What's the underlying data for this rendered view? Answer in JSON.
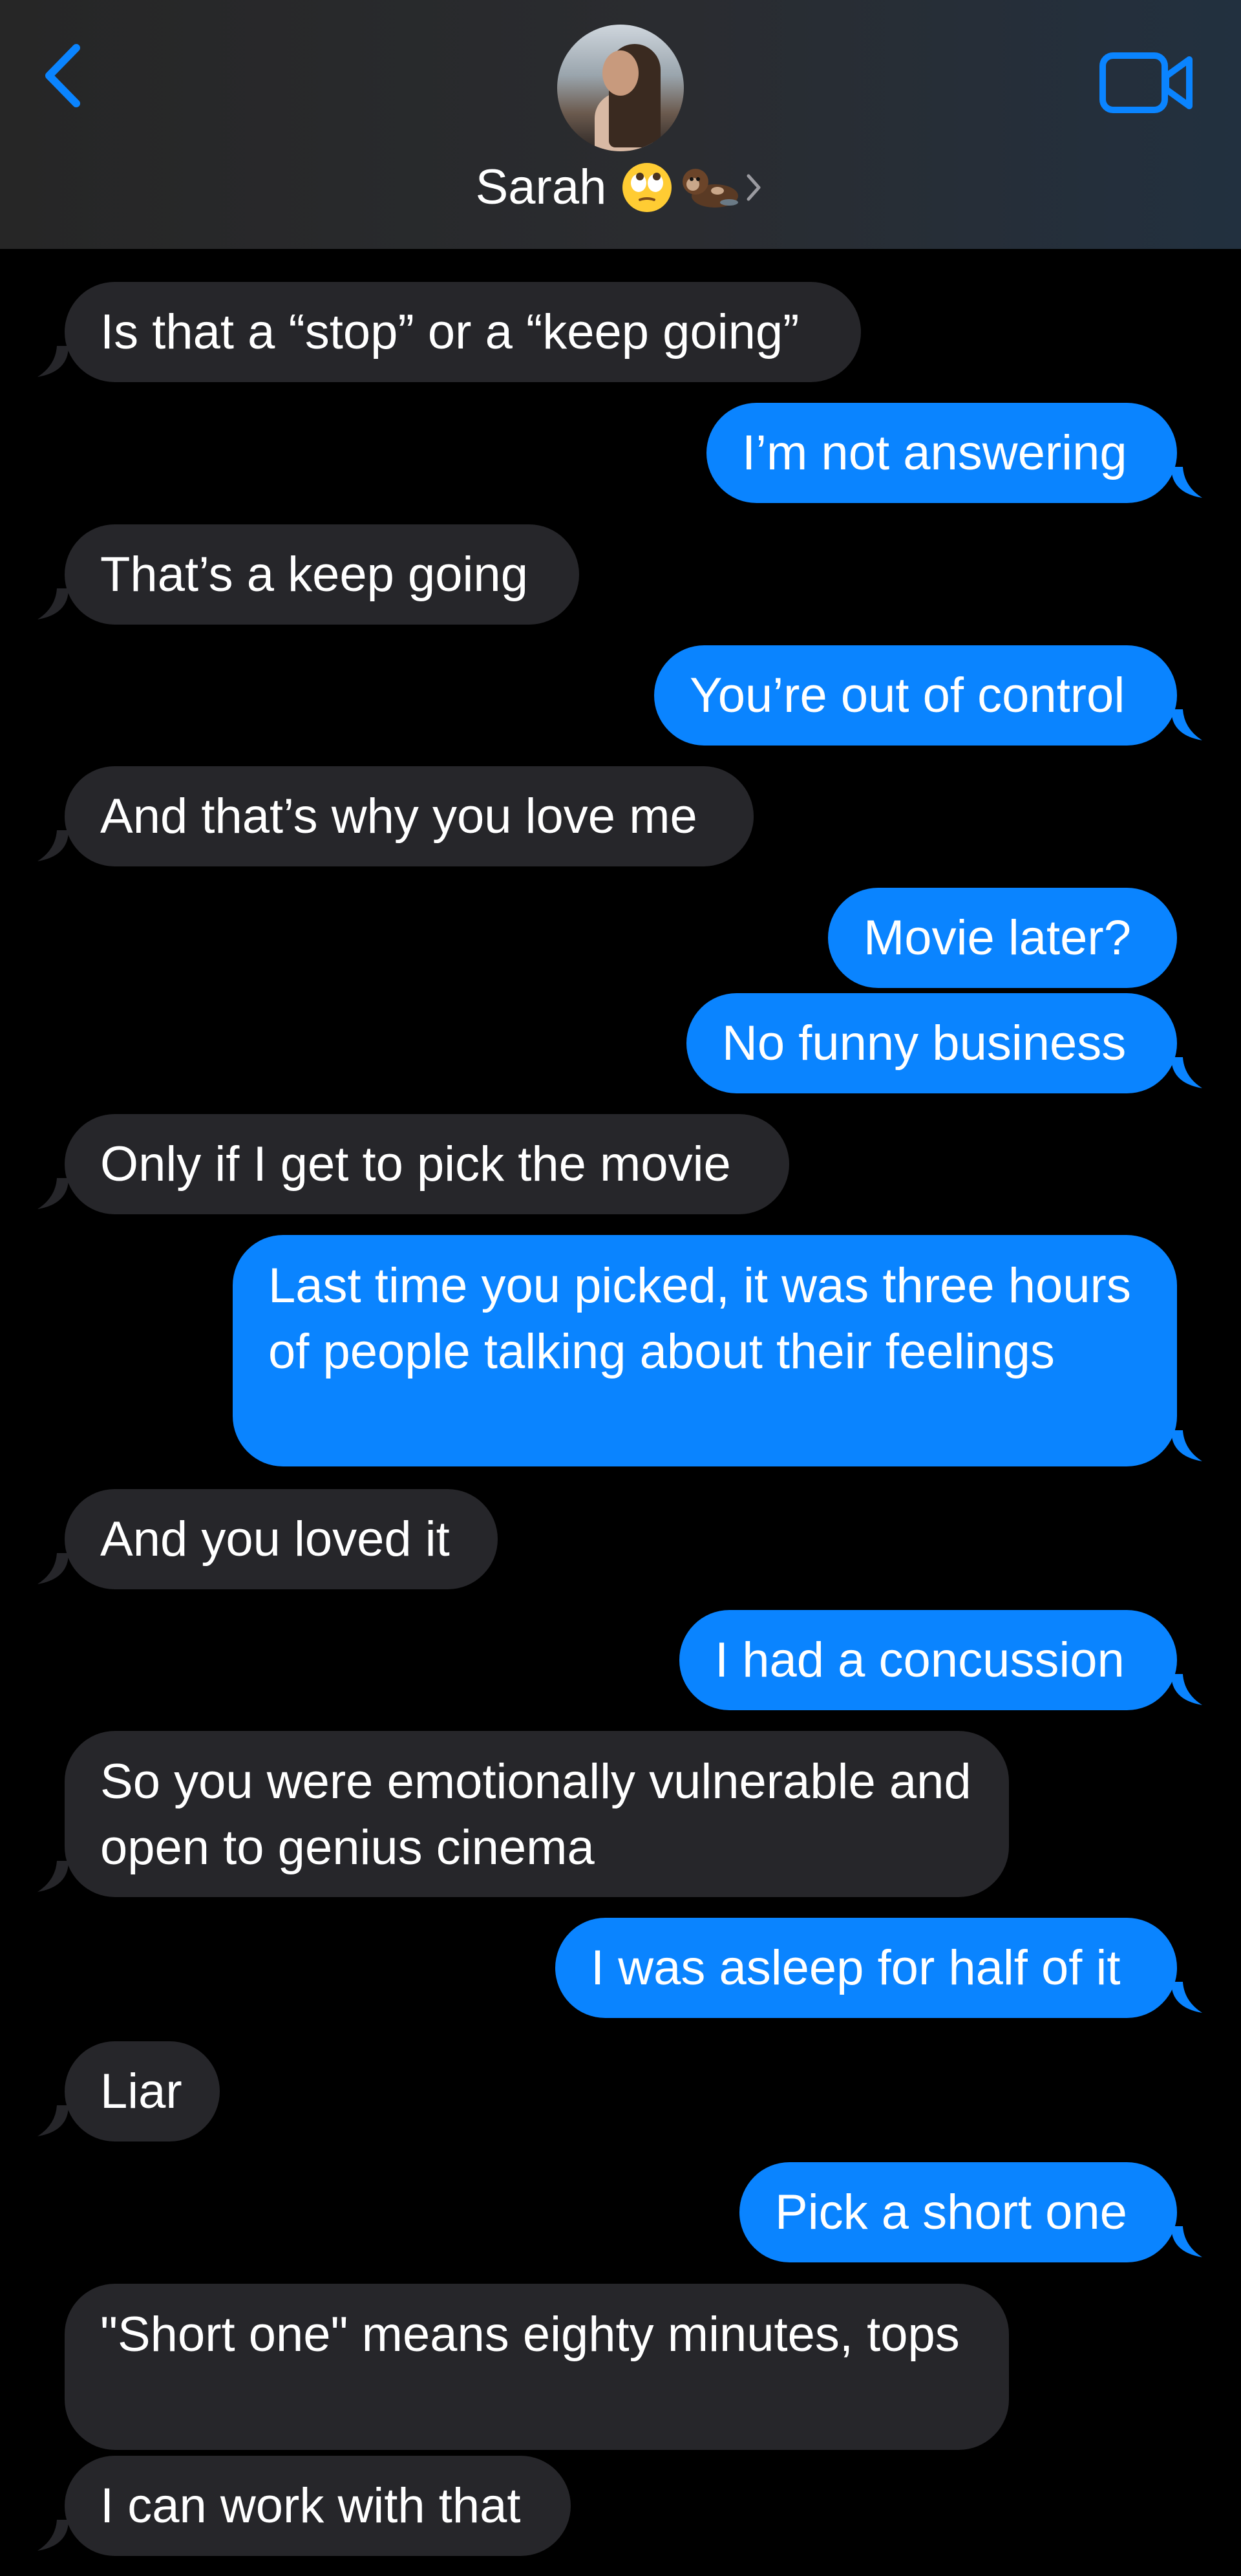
{
  "header": {
    "contact_name": "Sarah",
    "accent_color": "#0a84ff",
    "icons": {
      "back": "chevron-left-icon",
      "video": "video-camera-icon",
      "emoji_1": "face-with-rolling-eyes-emoji",
      "emoji_2": "otter-emoji",
      "disclosure": "chevron-right-icon"
    }
  },
  "colors": {
    "incoming_bubble": "#26262a",
    "outgoing_bubble": "#0a84ff",
    "background": "#000000"
  },
  "messages": [
    {
      "from": "them",
      "text": "Is that a “stop” or a “keep going”"
    },
    {
      "from": "me",
      "text": "I’m not answering"
    },
    {
      "from": "them",
      "text": "That’s a keep going"
    },
    {
      "from": "me",
      "text": "You’re out of control"
    },
    {
      "from": "them",
      "text": "And that’s why you love me"
    },
    {
      "from": "me",
      "text": "Movie later?"
    },
    {
      "from": "me",
      "text": "No funny business"
    },
    {
      "from": "them",
      "text": "Only if I get to pick the movie"
    },
    {
      "from": "me",
      "text": "Last time you picked, it was three hours of people talking about their feelings"
    },
    {
      "from": "them",
      "text": "And you loved it"
    },
    {
      "from": "me",
      "text": "I had a concussion"
    },
    {
      "from": "them",
      "text": "So you were emotionally vulnerable and open to genius cinema"
    },
    {
      "from": "me",
      "text": "I was asleep for half of it"
    },
    {
      "from": "them",
      "text": "Liar"
    },
    {
      "from": "me",
      "text": "Pick a short one"
    },
    {
      "from": "them",
      "text": "\"Short one\" means eighty minutes, tops"
    },
    {
      "from": "them",
      "text": "I can work with that"
    }
  ]
}
